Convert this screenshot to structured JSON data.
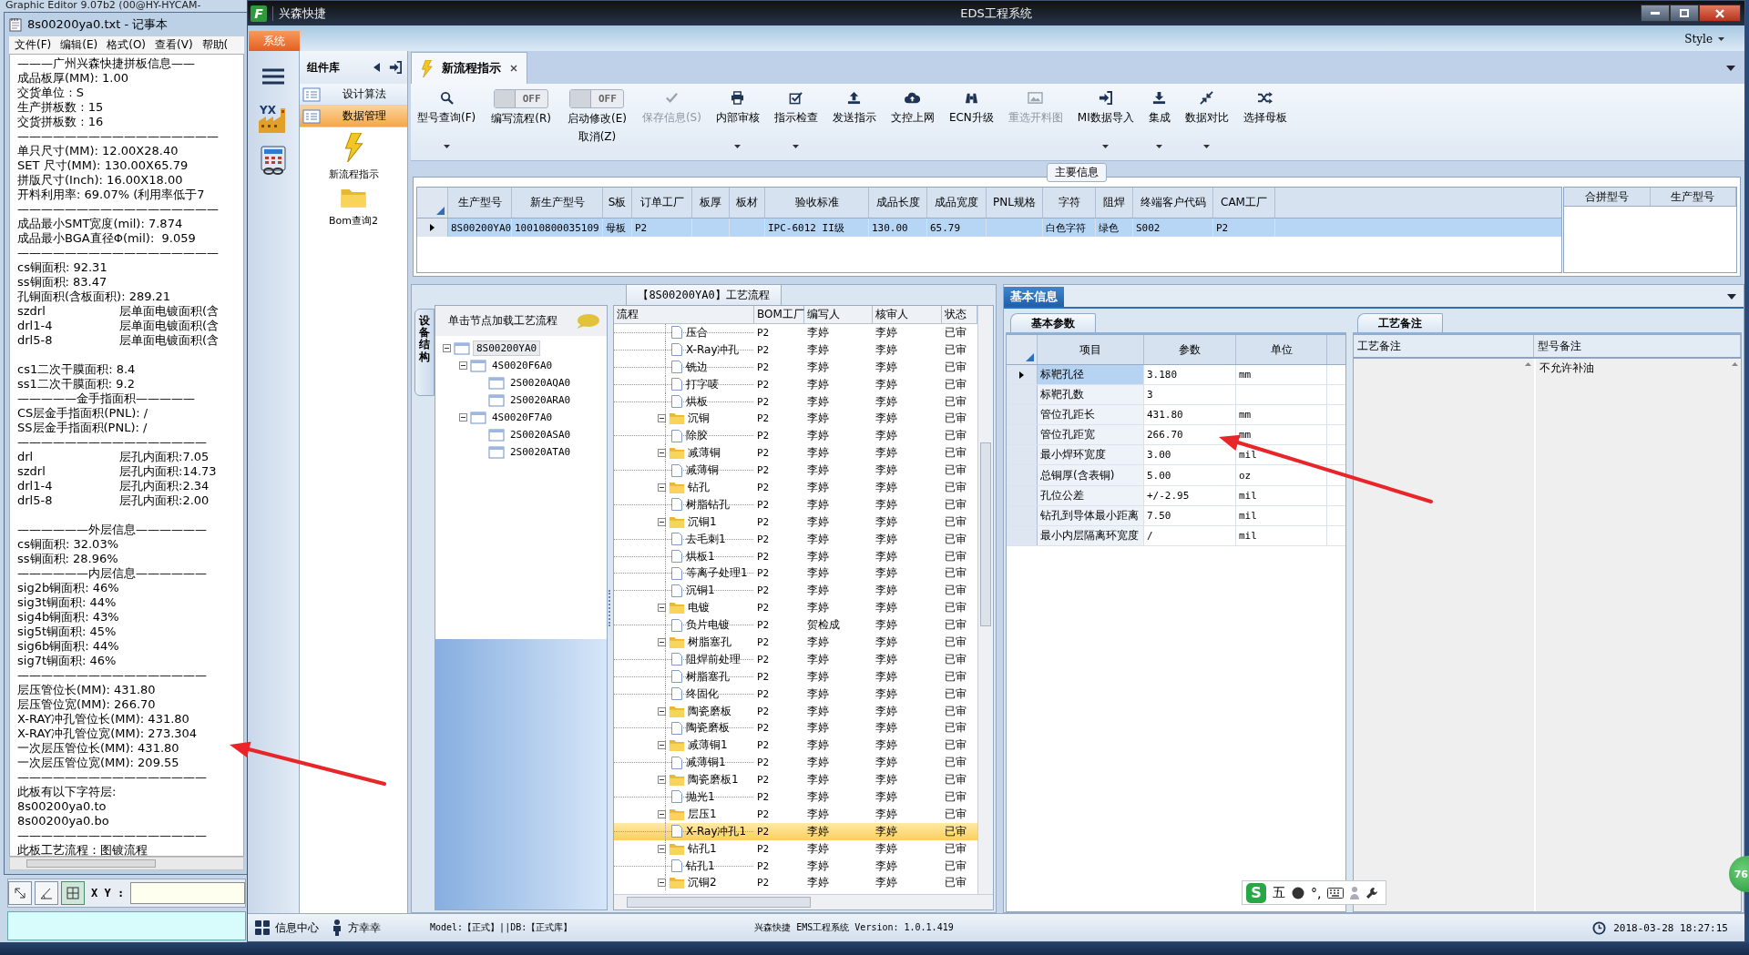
{
  "background_window": {
    "title": "Graphic Editor 9.07b2 (00@HY-HYCAM-",
    "coordinate_label": "X Y :",
    "tools": [
      {
        "selected": false
      },
      {
        "selected": false
      },
      {
        "selected": true
      }
    ]
  },
  "notepad": {
    "title": "8s00200ya0.txt - 记事本",
    "menu": [
      "文件(F)",
      "编辑(E)",
      "格式(O)",
      "查看(V)",
      "帮助("
    ],
    "paragraphs": [
      [
        "———广州兴森快捷拼板信息——",
        "成品板厚(MM): 1.00",
        "交货单位 : S",
        "生产拼板数 : 15",
        "交货拼板数 : 16",
        "—————————————————",
        "单只尺寸(MM): 12.00X28.40",
        "SET 尺寸(MM): 130.00X65.79",
        "拼版尺寸(Inch): 16.00X18.00",
        "开料利用率: 69.07% (利用率低于7",
        "—————————————————",
        "成品最小SMT宽度(mil): 7.874",
        "成品最小BGA直径Φ(mil):  9.059",
        "—————————————————",
        "cs铜面积: 92.31",
        "ss铜面积: 83.47",
        "孔铜面积(含板面积): 289.21",
        "szdrl\t层单面电镀面积(含",
        "drl1-4\t层单面电镀面积(含",
        "drl5-8\t层单面电镀面积(含"
      ],
      [
        "cs1二次干膜面积: 8.4",
        "ss1二次干膜面积: 9.2",
        "—————金手指面积—————",
        "CS层金手指面积(PNL): /",
        "SS层金手指面积(PNL): /",
        "————————————————",
        "drl\t层孔内面积:7.05",
        "szdrl\t层孔内面积:14.73",
        "drl1-4\t层孔内面积:2.34",
        "drl5-8\t层孔内面积:2.00"
      ],
      [
        "——————外层信息——————",
        "cs铜面积: 32.03%",
        "ss铜面积: 28.96%",
        "——————内层信息——————",
        "sig2b铜面积: 46%",
        "sig3t铜面积: 44%",
        "sig4b铜面积: 43%",
        "sig5t铜面积: 45%",
        "sig6b铜面积: 44%",
        "sig7t铜面积: 46%",
        "————————————————",
        "层压管位长(MM): 431.80",
        "层压管位宽(MM): 266.70",
        "X-RAY冲孔管位长(MM): 431.80",
        "X-RAY冲孔管位宽(MM): 273.304",
        "一次层压管位长(MM): 431.80",
        "一次层压管位宽(MM): 209.55",
        "————————————————",
        "此板有以下字符层:",
        "8s00200ya0.to",
        "8s00200ya0.bo",
        "————————————————",
        "此板工艺流程：图镀流程"
      ]
    ]
  },
  "window": {
    "logo": "F",
    "app_name": "兴森快捷",
    "title": "EDS工程系统",
    "system_tab": "系统",
    "style_menu": "Style"
  },
  "nav": {
    "factory_label": "YX"
  },
  "component_library": {
    "title": "组件库",
    "categories": [
      {
        "label": "设计算法",
        "selected": false
      },
      {
        "label": "数据管理",
        "selected": true
      }
    ],
    "tools": [
      {
        "label": "新流程指示",
        "kind": "lightning"
      },
      {
        "label": "Bom查询2",
        "kind": "folder"
      }
    ]
  },
  "document_tab": {
    "label": "新流程指示"
  },
  "ribbon": [
    {
      "kind": "button",
      "label": "型号查询(F)",
      "dropdown": true,
      "disabled": false
    },
    {
      "kind": "toggle",
      "label": "编写流程(R)",
      "switch_text": "OFF",
      "on": false
    },
    {
      "kind": "toggle",
      "label": "启动修改(E)",
      "sublabel": "取消(Z)",
      "switch_text": "OFF",
      "on": false
    },
    {
      "kind": "button",
      "label": "保存信息(S)",
      "dropdown": false,
      "disabled": true
    },
    {
      "kind": "button",
      "label": "内部审核",
      "dropdown": true,
      "disabled": false
    },
    {
      "kind": "button",
      "label": "指示检查",
      "dropdown": true,
      "disabled": false
    },
    {
      "kind": "button",
      "label": "发送指示",
      "dropdown": false,
      "disabled": false
    },
    {
      "kind": "button",
      "label": "文控上网",
      "dropdown": false,
      "disabled": false
    },
    {
      "kind": "button",
      "label": "ECN升级",
      "dropdown": false,
      "disabled": false
    },
    {
      "kind": "button",
      "label": "重选开料图",
      "dropdown": false,
      "disabled": true
    },
    {
      "kind": "button",
      "label": "MI数据导入",
      "dropdown": true,
      "disabled": false
    },
    {
      "kind": "button",
      "label": "集成",
      "dropdown": true,
      "disabled": false
    },
    {
      "kind": "button",
      "label": "数据对比",
      "dropdown": true,
      "disabled": false
    },
    {
      "kind": "button",
      "label": "选择母板",
      "dropdown": false,
      "disabled": false
    }
  ],
  "main_info": {
    "title": "主要信息",
    "columns": [
      "生产型号",
      "新生产型号",
      "S板",
      "订单工厂",
      "板厚",
      "板材",
      "验收标准",
      "成品长度",
      "成品宽度",
      "PNL规格",
      "字符",
      "阻焊",
      "终端客户代码",
      "CAM工厂"
    ],
    "rows": [
      {
        "selected": true,
        "cells": [
          "8S00200YA0",
          "10010800035109",
          "母板",
          "P2",
          null,
          null,
          "IPC-6012 II级",
          "130.00",
          "65.79",
          null,
          "白色字符",
          "绿色",
          "S002",
          "P2"
        ]
      }
    ],
    "side_columns": [
      "合拼型号",
      "生产型号"
    ]
  },
  "process_panel": {
    "title": "【8S00200YA0】工艺流程",
    "side_tab": "设备结构",
    "tree_hint": "单击节点加载工艺流程",
    "tree": [
      {
        "label": "8S00200YA0",
        "selected": true,
        "expanded": true,
        "children": [
          {
            "label": "4S0020F6A0",
            "selected": false,
            "expanded": true,
            "children": [
              {
                "label": "2S0020AQA0",
                "selected": false
              },
              {
                "label": "2S0020ARA0",
                "selected": false
              }
            ]
          },
          {
            "label": "4S0020F7A0",
            "selected": false,
            "expanded": true,
            "children": [
              {
                "label": "2S0020ASA0",
                "selected": false
              },
              {
                "label": "2S0020ATA0",
                "selected": false
              }
            ]
          }
        ]
      }
    ],
    "columns": [
      "流程",
      "BOM工厂",
      "编写人",
      "核审人",
      "状态"
    ],
    "rows": [
      {
        "kind": "step",
        "name": "压合",
        "bom": "P2",
        "author": "李婷",
        "reviewer": "李婷",
        "status": "已审",
        "selected": false
      },
      {
        "kind": "step",
        "name": "X-Ray冲孔",
        "bom": "P2",
        "author": "李婷",
        "reviewer": "李婷",
        "status": "已审",
        "selected": false
      },
      {
        "kind": "step",
        "name": "铣边",
        "bom": "P2",
        "author": "李婷",
        "reviewer": "李婷",
        "status": "已审",
        "selected": false
      },
      {
        "kind": "step",
        "name": "打字唛",
        "bom": "P2",
        "author": "李婷",
        "reviewer": "李婷",
        "status": "已审",
        "selected": false
      },
      {
        "kind": "step",
        "name": "烘板",
        "bom": "P2",
        "author": "李婷",
        "reviewer": "李婷",
        "status": "已审",
        "selected": false
      },
      {
        "kind": "group",
        "name": "沉铜",
        "bom": "P2",
        "author": "李婷",
        "reviewer": "李婷",
        "status": "已审",
        "selected": false,
        "expanded": true,
        "children": [
          {
            "kind": "step",
            "name": "除胶",
            "bom": "P2",
            "author": "李婷",
            "reviewer": "李婷",
            "status": "已审",
            "selected": false
          }
        ]
      },
      {
        "kind": "group",
        "name": "减薄铜",
        "bom": "P2",
        "author": "李婷",
        "reviewer": "李婷",
        "status": "已审",
        "selected": false,
        "expanded": true,
        "children": [
          {
            "kind": "step",
            "name": "减薄铜",
            "bom": "P2",
            "author": "李婷",
            "reviewer": "李婷",
            "status": "已审",
            "selected": false
          }
        ]
      },
      {
        "kind": "group",
        "name": "钻孔",
        "bom": "P2",
        "author": "李婷",
        "reviewer": "李婷",
        "status": "已审",
        "selected": false,
        "expanded": true,
        "children": [
          {
            "kind": "step",
            "name": "树脂钻孔",
            "bom": "P2",
            "author": "李婷",
            "reviewer": "李婷",
            "status": "已审",
            "selected": false
          }
        ]
      },
      {
        "kind": "group",
        "name": "沉铜1",
        "bom": "P2",
        "author": "李婷",
        "reviewer": "李婷",
        "status": "已审",
        "selected": false,
        "expanded": true,
        "children": [
          {
            "kind": "step",
            "name": "去毛刺1",
            "bom": "P2",
            "author": "李婷",
            "reviewer": "李婷",
            "status": "已审",
            "selected": false
          },
          {
            "kind": "step",
            "name": "烘板1",
            "bom": "P2",
            "author": "李婷",
            "reviewer": "李婷",
            "status": "已审",
            "selected": false
          },
          {
            "kind": "step",
            "name": "等离子处理1",
            "bom": "P2",
            "author": "李婷",
            "reviewer": "李婷",
            "status": "已审",
            "selected": false
          },
          {
            "kind": "step",
            "name": "沉铜1",
            "bom": "P2",
            "author": "李婷",
            "reviewer": "李婷",
            "status": "已审",
            "selected": false
          }
        ]
      },
      {
        "kind": "group",
        "name": "电镀",
        "bom": "P2",
        "author": "李婷",
        "reviewer": "李婷",
        "status": "已审",
        "selected": false,
        "expanded": true,
        "children": [
          {
            "kind": "step",
            "name": "负片电镀",
            "bom": "P2",
            "author": "贺检成",
            "reviewer": "李婷",
            "status": "已审",
            "selected": false
          }
        ]
      },
      {
        "kind": "group",
        "name": "树脂塞孔",
        "bom": "P2",
        "author": "李婷",
        "reviewer": "李婷",
        "status": "已审",
        "selected": false,
        "expanded": true,
        "children": [
          {
            "kind": "step",
            "name": "阻焊前处理",
            "bom": "P2",
            "author": "李婷",
            "reviewer": "李婷",
            "status": "已审",
            "selected": false
          },
          {
            "kind": "step",
            "name": "树脂塞孔",
            "bom": "P2",
            "author": "李婷",
            "reviewer": "李婷",
            "status": "已审",
            "selected": false
          },
          {
            "kind": "step",
            "name": "终固化",
            "bom": "P2",
            "author": "李婷",
            "reviewer": "李婷",
            "status": "已审",
            "selected": false
          }
        ]
      },
      {
        "kind": "group",
        "name": "陶瓷磨板",
        "bom": "P2",
        "author": "李婷",
        "reviewer": "李婷",
        "status": "已审",
        "selected": false,
        "expanded": true,
        "children": [
          {
            "kind": "step",
            "name": "陶瓷磨板",
            "bom": "P2",
            "author": "李婷",
            "reviewer": "李婷",
            "status": "已审",
            "selected": false
          }
        ]
      },
      {
        "kind": "group",
        "name": "减薄铜1",
        "bom": "P2",
        "author": "李婷",
        "reviewer": "李婷",
        "status": "已审",
        "selected": false,
        "expanded": true,
        "children": [
          {
            "kind": "step",
            "name": "减薄铜1",
            "bom": "P2",
            "author": "李婷",
            "reviewer": "李婷",
            "status": "已审",
            "selected": false
          }
        ]
      },
      {
        "kind": "group",
        "name": "陶瓷磨板1",
        "bom": "P2",
        "author": "李婷",
        "reviewer": "李婷",
        "status": "已审",
        "selected": false,
        "expanded": true,
        "children": [
          {
            "kind": "step",
            "name": "抛光1",
            "bom": "P2",
            "author": "李婷",
            "reviewer": "李婷",
            "status": "已审",
            "selected": false
          }
        ]
      },
      {
        "kind": "group",
        "name": "层压1",
        "bom": "P2",
        "author": "李婷",
        "reviewer": "李婷",
        "status": "已审",
        "selected": false,
        "expanded": true,
        "children": [
          {
            "kind": "step",
            "name": "X-Ray冲孔1",
            "bom": "P2",
            "author": "李婷",
            "reviewer": "李婷",
            "status": "已审",
            "selected": true
          }
        ]
      },
      {
        "kind": "group",
        "name": "钻孔1",
        "bom": "P2",
        "author": "李婷",
        "reviewer": "李婷",
        "status": "已审",
        "selected": false,
        "expanded": true,
        "children": [
          {
            "kind": "step",
            "name": "钻孔1",
            "bom": "P2",
            "author": "李婷",
            "reviewer": "李婷",
            "status": "已审",
            "selected": false
          }
        ]
      },
      {
        "kind": "group",
        "name": "沉铜2",
        "bom": "P2",
        "author": "李婷",
        "reviewer": "李婷",
        "status": "已审",
        "selected": false,
        "expanded": true
      }
    ]
  },
  "info_panel": {
    "title": "基本信息",
    "params": {
      "tab": "基本参数",
      "columns": [
        "项目",
        "参数",
        "单位"
      ],
      "rows": [
        {
          "item": "标靶孔径",
          "value": "3.180",
          "unit": "mm",
          "selected": true
        },
        {
          "item": "标靶孔数",
          "value": "3",
          "selected": false
        },
        {
          "item": "管位孔距长",
          "value": "431.80",
          "unit": "mm",
          "selected": false
        },
        {
          "item": "管位孔距宽",
          "value": "266.70",
          "unit": "mm",
          "selected": false
        },
        {
          "item": "最小焊环宽度",
          "value": "3.00",
          "unit": "mil",
          "selected": false
        },
        {
          "item": "总铜厚(含表铜)",
          "value": "5.00",
          "unit": "oz",
          "selected": false
        },
        {
          "item": "孔位公差",
          "value": "+/-2.95",
          "unit": "mil",
          "selected": false
        },
        {
          "item": "钻孔到导体最小距离",
          "value": "7.50",
          "unit": "mil",
          "selected": false
        },
        {
          "item": "最小内层隔离环宽度",
          "value": "/",
          "unit": "mil",
          "selected": false
        }
      ]
    },
    "notes": {
      "tab": "工艺备注",
      "columns": [
        "工艺备注",
        "型号备注"
      ],
      "model_note": "不允许补油"
    }
  },
  "status_bar": {
    "info_center": "信息中心",
    "user": "方幸幸",
    "environment": "Model:【正式】||DB:【正式库】",
    "version": "兴森快捷  EMS工程系统  Version: 1.0.1.419",
    "datetime": "2018-03-28 18:27:15"
  },
  "ime_toolbar": {
    "logo": "S",
    "mode": "五",
    "punctuation": "°,"
  },
  "badge": {
    "text": "76"
  }
}
